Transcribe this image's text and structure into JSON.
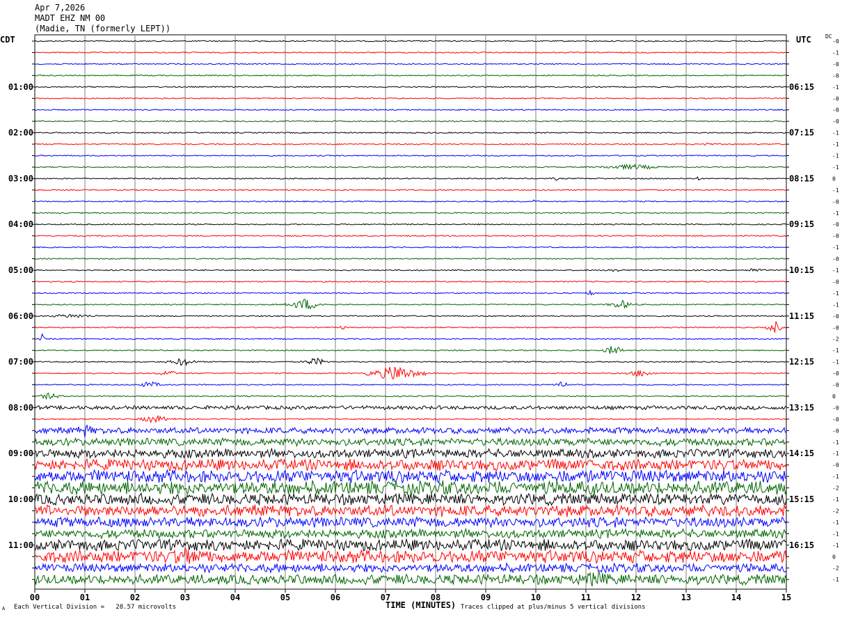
{
  "header": {
    "date": "Apr 7,2026",
    "station": "MADT EHZ NM 00",
    "location": "(Madie, TN (formerly LEPT))"
  },
  "left_zone": "CDT",
  "right_zone": "UTC",
  "dc_header": "DC",
  "footer": {
    "scale_note": "Each Vertical Division =   28.57 microvolts",
    "clip_note": "Traces clipped at plus/minus 5 vertical divisions",
    "corner_mark": "A"
  },
  "colors": {
    "black": "#000000",
    "red": "#ff0000",
    "blue": "#0000ff",
    "green": "#006400",
    "grid": "#808080"
  },
  "chart_data": {
    "type": "line",
    "xlabel": "TIME (MINUTES)",
    "x_ticks": [
      "00",
      "01",
      "02",
      "03",
      "04",
      "05",
      "06",
      "07",
      "08",
      "09",
      "10",
      "11",
      "12",
      "13",
      "14",
      "15"
    ],
    "xlim": [
      0,
      15
    ],
    "trace_minutes": 15,
    "trace_count": 48,
    "trace_colors": [
      "black",
      "red",
      "blue",
      "green"
    ],
    "left_labels": [
      {
        "trace": 4,
        "label": "01:00"
      },
      {
        "trace": 8,
        "label": "02:00"
      },
      {
        "trace": 12,
        "label": "03:00"
      },
      {
        "trace": 16,
        "label": "04:00"
      },
      {
        "trace": 20,
        "label": "05:00"
      },
      {
        "trace": 24,
        "label": "06:00"
      },
      {
        "trace": 28,
        "label": "07:00"
      },
      {
        "trace": 32,
        "label": "08:00"
      },
      {
        "trace": 36,
        "label": "09:00"
      },
      {
        "trace": 40,
        "label": "10:00"
      },
      {
        "trace": 44,
        "label": "11:00"
      }
    ],
    "right_labels": [
      {
        "trace": 4,
        "label": "06:15"
      },
      {
        "trace": 8,
        "label": "07:15"
      },
      {
        "trace": 12,
        "label": "08:15"
      },
      {
        "trace": 16,
        "label": "09:15"
      },
      {
        "trace": 20,
        "label": "10:15"
      },
      {
        "trace": 24,
        "label": "11:15"
      },
      {
        "trace": 28,
        "label": "12:15"
      },
      {
        "trace": 32,
        "label": "13:15"
      },
      {
        "trace": 36,
        "label": "14:15"
      },
      {
        "trace": 40,
        "label": "15:15"
      },
      {
        "trace": 44,
        "label": "16:15"
      }
    ],
    "dc_offsets": [
      "-0",
      "-1",
      "-0",
      "-0",
      "-1",
      "-0",
      "-0",
      "-0",
      "-1",
      "-1",
      "-1",
      "-1",
      "0",
      "-1",
      "-0",
      "-1",
      "-0",
      "-0",
      "-1",
      "-0",
      "-1",
      "-0",
      "-1",
      "-1",
      "-0",
      "-0",
      "-2",
      "-1",
      "-1",
      "-0",
      "-0",
      "0",
      "-0",
      "-0",
      "-0",
      "-1",
      "-1",
      "-0",
      "-1",
      "-2",
      "-1",
      "-2",
      "-1",
      "-1",
      "-1",
      "0",
      "-2",
      "-1"
    ],
    "activity": [
      {
        "trace": 9,
        "from": 13.2,
        "to": 13.6,
        "amp": 3
      },
      {
        "trace": 11,
        "from": 11.0,
        "to": 12.8,
        "amp": 4
      },
      {
        "trace": 12,
        "from": 10.3,
        "to": 10.5,
        "amp": 3
      },
      {
        "trace": 12,
        "from": 13.15,
        "to": 13.3,
        "amp": 4
      },
      {
        "trace": 14,
        "from": 9.9,
        "to": 10.0,
        "amp": 5
      },
      {
        "trace": 20,
        "from": 11.3,
        "to": 11.8,
        "amp": 3
      },
      {
        "trace": 20,
        "from": 14.0,
        "to": 14.7,
        "amp": 3
      },
      {
        "trace": 22,
        "from": 11.0,
        "to": 11.2,
        "amp": 5
      },
      {
        "trace": 23,
        "from": 5.0,
        "to": 5.8,
        "amp": 9
      },
      {
        "trace": 23,
        "from": 11.4,
        "to": 12.0,
        "amp": 7
      },
      {
        "trace": 24,
        "from": 0.0,
        "to": 1.5,
        "amp": 3
      },
      {
        "trace": 25,
        "from": 14.6,
        "to": 14.95,
        "amp": 10
      },
      {
        "trace": 25,
        "from": 6.0,
        "to": 6.3,
        "amp": 3
      },
      {
        "trace": 26,
        "from": 0.1,
        "to": 0.2,
        "amp": 8
      },
      {
        "trace": 27,
        "from": 11.3,
        "to": 11.8,
        "amp": 8
      },
      {
        "trace": 28,
        "from": 2.6,
        "to": 3.3,
        "amp": 6
      },
      {
        "trace": 28,
        "from": 5.3,
        "to": 5.9,
        "amp": 6
      },
      {
        "trace": 29,
        "from": 2.4,
        "to": 2.9,
        "amp": 5
      },
      {
        "trace": 29,
        "from": 6.6,
        "to": 7.8,
        "amp": 12
      },
      {
        "trace": 29,
        "from": 11.8,
        "to": 12.4,
        "amp": 6
      },
      {
        "trace": 30,
        "from": 2.0,
        "to": 2.6,
        "amp": 5
      },
      {
        "trace": 30,
        "from": 10.3,
        "to": 10.7,
        "amp": 6
      },
      {
        "trace": 31,
        "from": 0.0,
        "to": 0.6,
        "amp": 5
      },
      {
        "trace": 32,
        "from": 0.0,
        "to": 15.0,
        "amp": 3
      },
      {
        "trace": 33,
        "from": 2.0,
        "to": 2.8,
        "amp": 6
      },
      {
        "trace": 34,
        "from": 0.0,
        "to": 15.0,
        "amp": 5
      },
      {
        "trace": 34,
        "from": 0.7,
        "to": 1.3,
        "amp": 10
      },
      {
        "trace": 35,
        "from": 0.0,
        "to": 15.0,
        "amp": 6
      },
      {
        "trace": 36,
        "from": 0.0,
        "to": 15.0,
        "amp": 7
      },
      {
        "trace": 37,
        "from": 0.0,
        "to": 15.0,
        "amp": 9
      },
      {
        "trace": 38,
        "from": 0.0,
        "to": 15.0,
        "amp": 10
      },
      {
        "trace": 39,
        "from": 0.0,
        "to": 15.0,
        "amp": 11
      },
      {
        "trace": 40,
        "from": 0.0,
        "to": 15.0,
        "amp": 9
      },
      {
        "trace": 41,
        "from": 0.0,
        "to": 15.0,
        "amp": 9
      },
      {
        "trace": 42,
        "from": 0.0,
        "to": 15.0,
        "amp": 8
      },
      {
        "trace": 43,
        "from": 0.0,
        "to": 15.0,
        "amp": 7
      },
      {
        "trace": 44,
        "from": 0.0,
        "to": 15.0,
        "amp": 9
      },
      {
        "trace": 45,
        "from": 0.0,
        "to": 15.0,
        "amp": 10
      },
      {
        "trace": 45,
        "from": 2.3,
        "to": 3.8,
        "amp": 14
      },
      {
        "trace": 46,
        "from": 0.0,
        "to": 15.0,
        "amp": 7
      },
      {
        "trace": 47,
        "from": 0.0,
        "to": 15.0,
        "amp": 8
      },
      {
        "trace": 47,
        "from": 10.2,
        "to": 12.2,
        "amp": 11
      }
    ],
    "grid": true
  }
}
